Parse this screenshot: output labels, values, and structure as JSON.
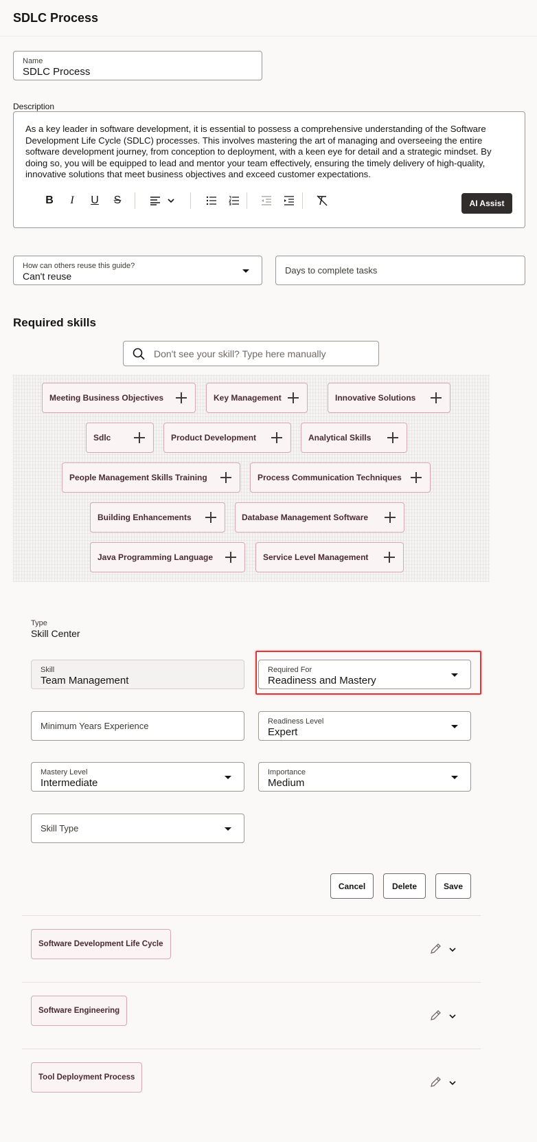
{
  "page": {
    "title": "SDLC Process"
  },
  "name_field": {
    "label": "Name",
    "value": "SDLC Process"
  },
  "description": {
    "label": "Description",
    "text": "As a key leader in software development, it is essential to possess a comprehensive understanding of the Software Development Life Cycle (SDLC) processes. This involves mastering the art of managing and overseeing the entire software development journey, from conception to deployment, with a keen eye for detail and a strategic mindset. By doing so, you will be equipped to lead and mentor your team effectively, ensuring the timely delivery of high-quality, innovative solutions that meet business objectives and exceed customer expectations.",
    "toolbar_icons": [
      "bold-icon",
      "italic-icon",
      "underline-icon",
      "strikethrough-icon",
      "align-left-icon",
      "chevron-down-icon",
      "bulleted-list-icon",
      "numbered-list-icon",
      "outdent-icon",
      "indent-icon",
      "clear-format-icon"
    ],
    "toolbar_glyphs": {
      "bold": "B",
      "italic": "I",
      "underline": "U",
      "strike": "S"
    },
    "ai_assist_label": "AI Assist"
  },
  "reuse_select": {
    "label": "How can others reuse this guide?",
    "value": "Can't reuse"
  },
  "days_field": {
    "placeholder": "Days to complete tasks"
  },
  "required_skills": {
    "title": "Required skills",
    "search_placeholder": "Don't see your skill? Type here manually",
    "suggestions": [
      "Meeting Business Objectives",
      "Key Management",
      "Innovative Solutions",
      "Sdlc",
      "Product Development",
      "Analytical Skills",
      "People Management Skills Training",
      "Process Communication Techniques",
      "Building Enhancements",
      "Database Management Software",
      "Java Programming Language",
      "Service Level Management"
    ]
  },
  "skill_form": {
    "type_label": "Type",
    "type_value": "Skill Center",
    "skill": {
      "label": "Skill",
      "value": "Team Management"
    },
    "required_for": {
      "label": "Required For",
      "value": "Readiness and Mastery"
    },
    "min_years": {
      "placeholder": "Minimum Years Experience"
    },
    "readiness_level": {
      "label": "Readiness Level",
      "value": "Expert"
    },
    "mastery_level": {
      "label": "Mastery Level",
      "value": "Intermediate"
    },
    "importance": {
      "label": "Importance",
      "value": "Medium"
    },
    "skill_type": {
      "placeholder": "Skill Type"
    },
    "buttons": {
      "cancel": "Cancel",
      "delete": "Delete",
      "save": "Save"
    }
  },
  "skill_rows": [
    {
      "label": "Software Development Life Cycle"
    },
    {
      "label": "Software Engineering"
    },
    {
      "label": "Tool Deployment Process"
    }
  ],
  "colors": {
    "accent_dark": "#312d2a",
    "chip_border": "#d9a7b3",
    "chip_bg": "#fbf4f4",
    "highlight": "#d9383a"
  }
}
